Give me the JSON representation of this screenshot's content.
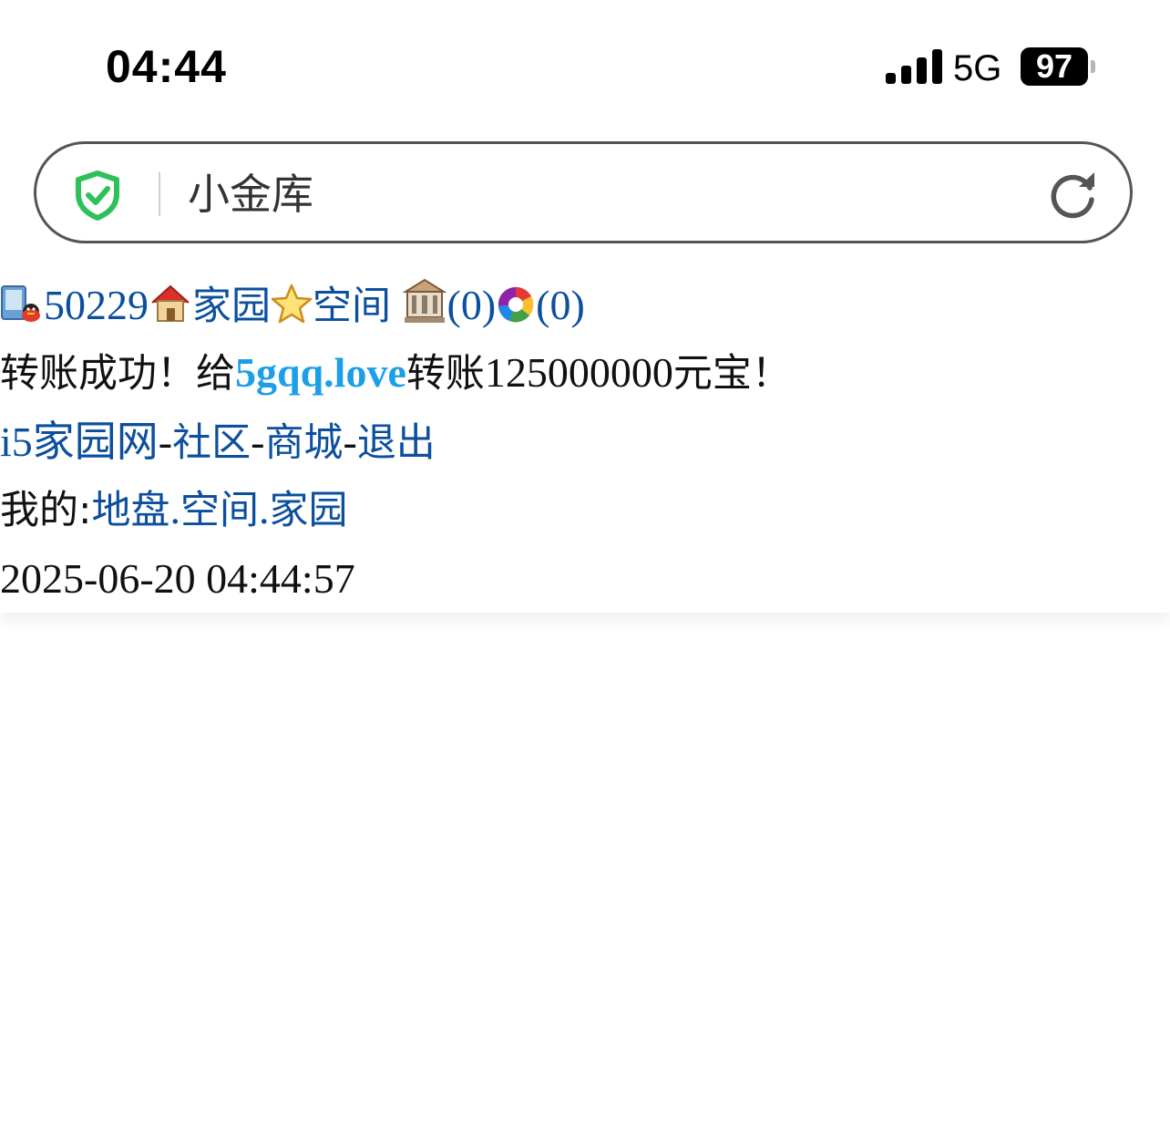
{
  "status_bar": {
    "time": "04:44",
    "network": "5G",
    "battery": "97"
  },
  "address_bar": {
    "title": "小金库"
  },
  "user_line": {
    "user_id": "50229",
    "home_link": "家园",
    "space_link": "空间",
    "bank_count": "(0)",
    "album_count": "(0)"
  },
  "message": {
    "prefix": "转账成功！给",
    "recipient": "5gqq.love",
    "mid": "转账",
    "amount": "125000000",
    "suffix": "元宝！"
  },
  "nav_links": {
    "home_site": "i5家园网",
    "sep": "-",
    "community": "社区",
    "shop": "商城",
    "logout": "退出"
  },
  "my_links": {
    "label": "我的:",
    "land": "地盘",
    "dot": ".",
    "space": "空间",
    "home": "家园"
  },
  "timestamp": "2025-06-20 04:44:57",
  "colors": {
    "link": "#0b4f9e",
    "highlight_link": "#1c9ee8",
    "shield": "#2ec15a"
  }
}
